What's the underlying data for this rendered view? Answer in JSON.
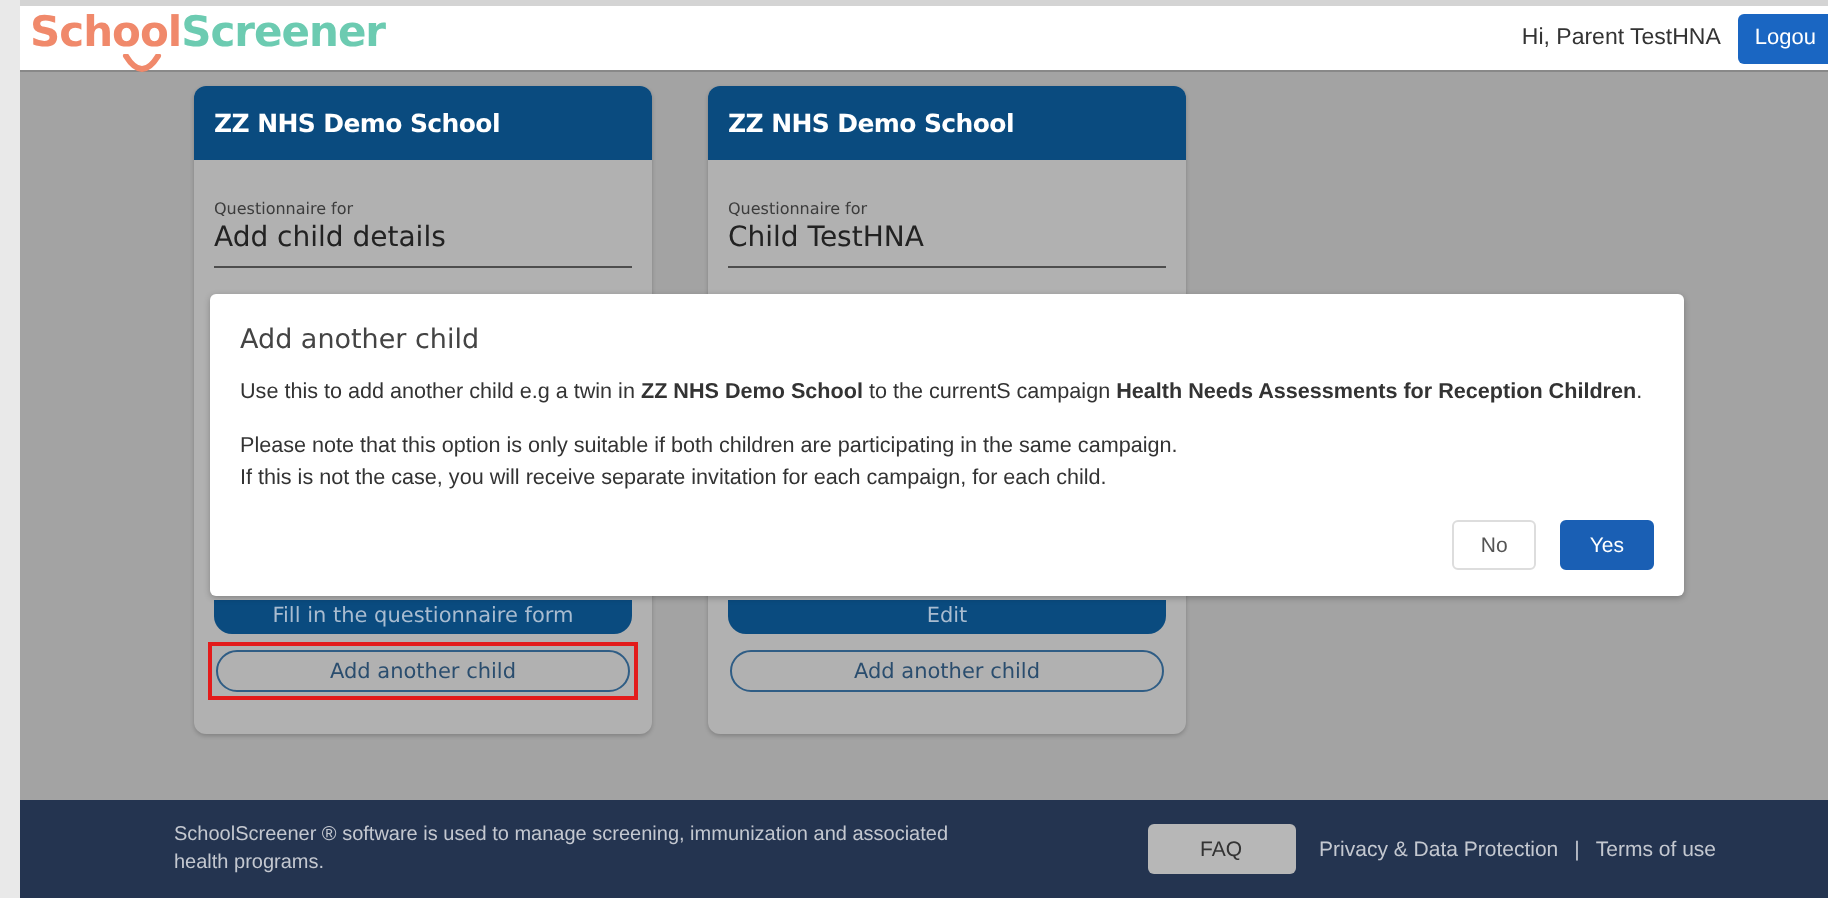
{
  "header": {
    "logo": {
      "part_1": "School",
      "part_2": "Screener"
    },
    "greeting": "Hi, Parent TestHNA",
    "logout_button": "Logou"
  },
  "cards": [
    {
      "school": "ZZ NHS Demo School",
      "caption": "Questionnaire for",
      "child": "Add child details",
      "primary_button": "Fill in the questionnaire form",
      "secondary_button": "Add another child",
      "highlighted": true
    },
    {
      "school": "ZZ NHS Demo School",
      "caption": "Questionnaire for",
      "child": "Child TestHNA",
      "primary_button": "Edit",
      "secondary_button": "Add another child",
      "highlighted": false
    }
  ],
  "dialog": {
    "title": "Add another child",
    "paragraphs": [
      {
        "lines": [
          "Use this to add another child e.g a twin in **ZZ NHS Demo School** to the currentS campaign **Health Needs Assessments for Reception Children**."
        ]
      },
      {
        "lines": [
          "Please note that this option is only suitable if both children are participating in the same campaign.",
          "If this is not the case, you will receive separate invitation for each campaign, for each child."
        ]
      }
    ],
    "buttons": [
      {
        "label": "No",
        "kind": "secondary"
      },
      {
        "label": "Yes",
        "kind": "primary"
      }
    ]
  },
  "footer": {
    "text": "SchoolScreener ® software is used to manage screening, immunization and associated health programs.",
    "faq_button": "FAQ",
    "links": [
      "Privacy & Data Protection",
      "Terms of use"
    ],
    "separator": "|"
  }
}
